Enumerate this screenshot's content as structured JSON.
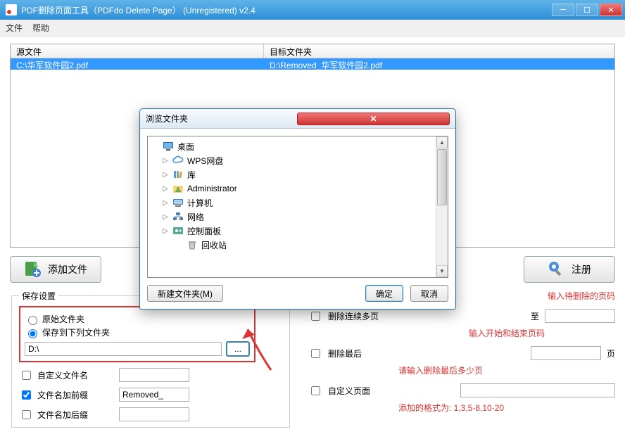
{
  "window": {
    "title": "PDF删除页面工具（PDFdo Delete Page） (Unregistered) v2.4"
  },
  "menu": {
    "file": "文件",
    "help": "帮助"
  },
  "table": {
    "cols": {
      "source": "源文件",
      "target": "目标文件夹"
    },
    "rows": [
      {
        "source": "C:\\华军软件园2.pdf",
        "target": "D:\\Removed_华军软件园2.pdf"
      }
    ]
  },
  "buttons": {
    "add_file": "添加文件",
    "register": "注册"
  },
  "save": {
    "legend": "保存设置",
    "radio_original": "原始文件夹",
    "radio_below": "保存到下列文件夹",
    "path": "D:\\",
    "custom_name": "自定义文件名",
    "prefix": "文件名加前缀",
    "prefix_value": "Removed_",
    "suffix": "文件名加后缀"
  },
  "right": {
    "del_seq": "删除连续多页",
    "to": "至",
    "hint1": "输入待删除的页码",
    "hint2": "输入开始和结束页码",
    "del_last": "删除最后",
    "page": "页",
    "hint3": "请输入删除最后多少页",
    "custom_pages": "自定义页面",
    "hint4": "添加的格式为:  1,3,5-8,10-20"
  },
  "dialog": {
    "title": "浏览文件夹",
    "tree": [
      {
        "label": "桌面",
        "icon": "monitor",
        "expand": "",
        "indent": 0
      },
      {
        "label": "WPS网盘",
        "icon": "cloud",
        "expand": "▷",
        "indent": 1
      },
      {
        "label": "库",
        "icon": "library",
        "expand": "▷",
        "indent": 1
      },
      {
        "label": "Administrator",
        "icon": "user",
        "expand": "▷",
        "indent": 1
      },
      {
        "label": "计算机",
        "icon": "computer",
        "expand": "▷",
        "indent": 1
      },
      {
        "label": "网络",
        "icon": "network",
        "expand": "▷",
        "indent": 1
      },
      {
        "label": "控制面板",
        "icon": "control",
        "expand": "▷",
        "indent": 1
      },
      {
        "label": "回收站",
        "icon": "recycle",
        "expand": "",
        "indent": 2
      }
    ],
    "new_folder": "新建文件夹(M)",
    "ok": "确定",
    "cancel": "取消"
  }
}
